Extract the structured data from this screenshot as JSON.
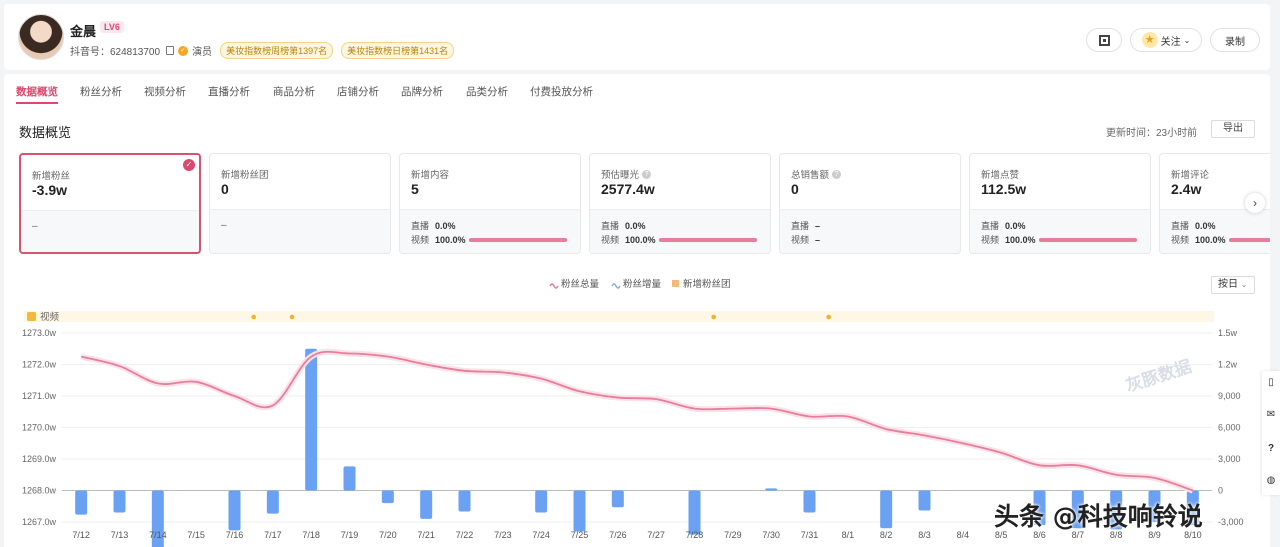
{
  "profile": {
    "name": "金晨",
    "level": "LV6",
    "douyin_id": "抖音号：624813700",
    "role": "演员",
    "badges": [
      "美妆指数榜周榜第1397名",
      "美妆指数榜日榜第1431名"
    ]
  },
  "header_actions": {
    "follow_label": "关注",
    "record_label": "录制"
  },
  "tabs": [
    "数据概览",
    "粉丝分析",
    "视频分析",
    "直播分析",
    "商品分析",
    "店铺分析",
    "品牌分析",
    "品类分析",
    "付费投放分析"
  ],
  "section": {
    "title": "数据概览",
    "update_time": "更新时间：23小时前",
    "export_label": "导出"
  },
  "cards": [
    {
      "label": "新增粉丝",
      "value": "-3.9w",
      "dash": "–"
    },
    {
      "label": "新增粉丝团",
      "value": "0",
      "dash": "–"
    },
    {
      "label": "新增内容",
      "value": "5",
      "live": "0.0%",
      "video": "100.0%",
      "video_share": 1.0
    },
    {
      "label": "预估曝光",
      "value": "2577.4w",
      "live": "0.0%",
      "video": "100.0%",
      "video_share": 1.0
    },
    {
      "label": "总销售额",
      "value": "0",
      "live": "–",
      "video": "–"
    },
    {
      "label": "新增点赞",
      "value": "112.5w",
      "live": "0.0%",
      "video": "100.0%",
      "video_share": 1.0
    },
    {
      "label": "新增评论",
      "value": "2.4w",
      "live": "0.0%",
      "video": "100.0%",
      "video_share": 1.0
    }
  ],
  "row_labels": {
    "live": "直播",
    "video": "视频"
  },
  "period_label": "按日",
  "video_track_label": "视频",
  "colors": {
    "accent": "#e0476f",
    "line": "#e77e9b",
    "bar": "#6ba1f2",
    "fan_club": "#f5b97a"
  },
  "chart_data": {
    "type": "bar",
    "legend": [
      "粉丝总量",
      "粉丝增量",
      "新增粉丝团"
    ],
    "categories": [
      "7/12",
      "7/13",
      "7/14",
      "7/15",
      "7/16",
      "7/17",
      "7/18",
      "7/19",
      "7/20",
      "7/21",
      "7/22",
      "7/23",
      "7/24",
      "7/25",
      "7/26",
      "7/27",
      "7/28",
      "7/29",
      "7/30",
      "7/31",
      "8/1",
      "8/2",
      "8/3",
      "8/4",
      "8/5",
      "8/6",
      "8/7",
      "8/8",
      "8/9",
      "8/10"
    ],
    "left_axis": {
      "ticks": [
        "1267.0w",
        "1268.0w",
        "1269.0w",
        "1270.0w",
        "1271.0w",
        "1272.0w",
        "1273.0w"
      ],
      "ylim": [
        1267.0,
        1273.0
      ]
    },
    "right_axis": {
      "ticks": [
        "-3,000",
        "0",
        "3,000",
        "6,000",
        "9,000",
        "1.2w",
        "1.5w"
      ],
      "ylim": [
        -3000,
        15000
      ]
    },
    "series": [
      {
        "name": "粉丝总量",
        "type": "line",
        "axis": "left",
        "values": [
          1272.25,
          1271.95,
          1271.4,
          1271.45,
          1271.0,
          1270.7,
          1272.25,
          1272.35,
          1272.25,
          1272.0,
          1271.8,
          1271.75,
          1271.55,
          1271.15,
          1270.95,
          1270.9,
          1270.6,
          1270.6,
          1270.6,
          1270.35,
          1270.35,
          1269.95,
          1269.75,
          1269.5,
          1269.2,
          1268.8,
          1268.8,
          1268.5,
          1268.4,
          1268.0
        ]
      },
      {
        "name": "粉丝增量",
        "type": "bar",
        "axis": "right",
        "values": [
          -2300,
          -2100,
          -5700,
          0,
          -3800,
          -2200,
          13500,
          2300,
          -1200,
          -2700,
          -2000,
          0,
          -2100,
          -3900,
          -1600,
          0,
          -4200,
          0,
          200,
          -2100,
          0,
          -3600,
          -1900,
          0,
          0,
          -3300,
          -3600,
          -3700,
          -3000,
          -3300
        ]
      },
      {
        "name": "新增粉丝团",
        "type": "bar",
        "axis": "right",
        "values": []
      }
    ],
    "video_markers": [
      "7/17",
      "7/18",
      "7/29",
      "8/1"
    ]
  },
  "watermark": "头条 @科技响铃说",
  "chart_watermark": "灰豚数据"
}
